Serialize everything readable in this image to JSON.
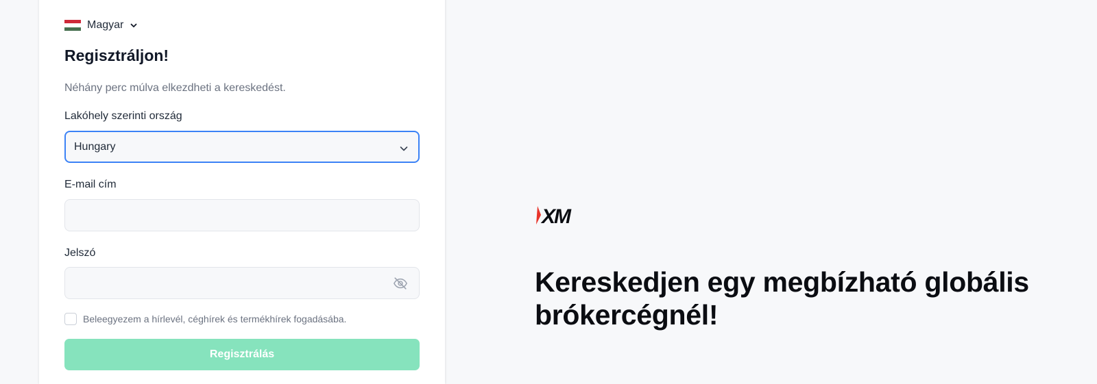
{
  "language": {
    "label": "Magyar",
    "flag_colors": [
      "#ce2939",
      "#ffffff",
      "#477050"
    ]
  },
  "form": {
    "title": "Regisztráljon!",
    "subtitle": "Néhány perc múlva elkezdheti a kereskedést.",
    "country": {
      "label": "Lakóhely szerinti ország",
      "value": "Hungary"
    },
    "email": {
      "label": "E-mail cím",
      "value": "",
      "placeholder": ""
    },
    "password": {
      "label": "Jelszó",
      "value": "",
      "placeholder": ""
    },
    "newsletter": {
      "label": "Beleegyezem a hírlevél, céghírek és termékhírek fogadásába.",
      "checked": false
    },
    "submit_label": "Regisztrálás"
  },
  "hero": {
    "logo_text": "XM",
    "headline": "Kereskedjen egy megbízható globális brókercégnél!"
  },
  "colors": {
    "accent_focus": "#3b82f6",
    "submit_disabled": "#86e3bd",
    "brand_red": "#e8352b"
  }
}
